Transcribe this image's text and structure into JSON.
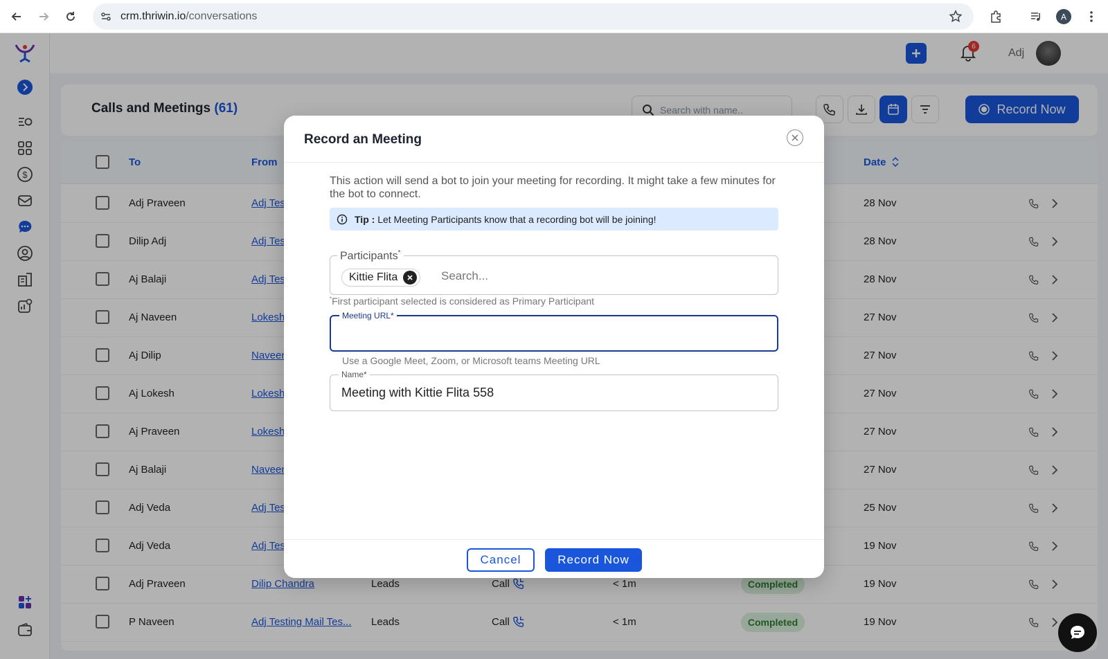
{
  "browser": {
    "url_host": "crm.thriwin.io",
    "url_path": "/conversations"
  },
  "topbar": {
    "notification_count": "6",
    "user_name": "Adj"
  },
  "page": {
    "title": "Calls and Meetings",
    "count": "(61)",
    "search_placeholder": "Search with name..",
    "record_now_label": "Record Now"
  },
  "table": {
    "headers": {
      "to": "To",
      "from": "From",
      "date": "Date"
    },
    "rows": [
      {
        "to": "Adj Praveen",
        "from": "Adj Tes",
        "type": "",
        "channel": "",
        "duration": "",
        "status": "",
        "date": "28 Nov"
      },
      {
        "to": "Dilip Adj",
        "from": "Adj Tes",
        "type": "",
        "channel": "",
        "duration": "",
        "status": "",
        "date": "28 Nov"
      },
      {
        "to": "Aj Balaji",
        "from": "Adj Tes",
        "type": "",
        "channel": "",
        "duration": "",
        "status": "",
        "date": "28 Nov"
      },
      {
        "to": "Aj Naveen",
        "from": "Lokesh",
        "type": "",
        "channel": "",
        "duration": "",
        "status": "",
        "date": "27 Nov"
      },
      {
        "to": "Aj Dilip",
        "from": "Naveen",
        "type": "",
        "channel": "",
        "duration": "",
        "status": "",
        "date": "27 Nov"
      },
      {
        "to": "Aj Lokesh",
        "from": "Lokesh",
        "type": "",
        "channel": "",
        "duration": "",
        "status": "",
        "date": "27 Nov"
      },
      {
        "to": "Aj Praveen",
        "from": "Lokesh",
        "type": "",
        "channel": "",
        "duration": "",
        "status": "",
        "date": "27 Nov"
      },
      {
        "to": "Aj Balaji",
        "from": "Naveen",
        "type": "",
        "channel": "",
        "duration": "",
        "status": "",
        "date": "27 Nov"
      },
      {
        "to": "Adj Veda",
        "from": "Adj Tes",
        "type": "",
        "channel": "",
        "duration": "",
        "status": "",
        "date": "25 Nov"
      },
      {
        "to": "Adj Veda",
        "from": "Adj Tes",
        "type": "",
        "channel": "",
        "duration": "",
        "status": "",
        "date": "19 Nov"
      },
      {
        "to": "Adj Praveen",
        "from": "Dilip Chandra",
        "type": "Leads",
        "channel": "Call",
        "duration": "< 1m",
        "status": "Completed",
        "date": "19 Nov"
      },
      {
        "to": "P Naveen",
        "from": "Adj Testing Mail Tes...",
        "type": "Leads",
        "channel": "Call",
        "duration": "< 1m",
        "status": "Completed",
        "date": "19 Nov"
      }
    ]
  },
  "modal": {
    "title": "Record an Meeting",
    "description": "This action will send a bot to join your meeting for recording. It might take a few minutes for the bot to connect.",
    "tip_label": "Tip :",
    "tip_text": "Let Meeting Participants know that a recording bot will be joining!",
    "participants_label": "Participants",
    "participants_asterisk": "*",
    "participant_chip": "Kittie Flita",
    "participants_search_placeholder": "Search...",
    "participants_helper_asterisk": "*",
    "participants_helper": "First participant selected is considered as Primary Participant",
    "meeting_url_label": "Meeting URL*",
    "meeting_url_value": "",
    "meeting_url_helper": "Use a Google Meet, Zoom, or Microsoft teams Meeting URL",
    "name_label": "Name*",
    "name_value": "Meeting with Kittie Flita 558",
    "cancel_label": "Cancel",
    "record_label": "Record Now"
  },
  "colors": {
    "primary": "#1a56db",
    "completed_bg": "#d8f0dc",
    "completed_text": "#2e7d32",
    "notification": "#e53935"
  }
}
